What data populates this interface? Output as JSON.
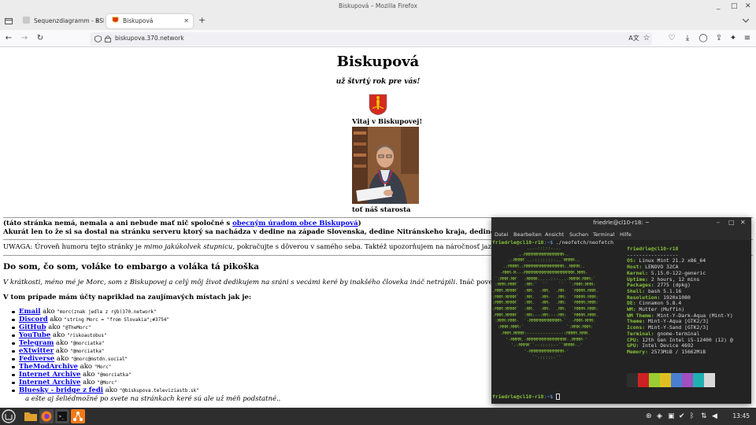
{
  "window": {
    "title": "Biskupová – Mozilla Firefox",
    "controls": [
      "_",
      "□",
      "✕"
    ]
  },
  "tabs": [
    {
      "label": "Sequenzdiagramm - BSIT1_I",
      "active": false
    },
    {
      "label": "Biskupová",
      "active": true
    }
  ],
  "new_tab_label": "+",
  "url": "biskupova.370.network",
  "page": {
    "title": "Biskupová",
    "subtitle": "už štvrtý rok pre vás!",
    "welcome": "Vitaj v Biskupovej!",
    "mayor_caption": "toť náš starosta",
    "disclaimer_pre": "(táto stránka nemá, nemala a ani nebude mať nič spoločné s ",
    "disclaimer_link": "obecným úradom obce Biskupová",
    "disclaimer_post": ")",
    "location": "Akurát len to že si sa dostal na stránku serveru ktorý sa nachádza v dedine na západe Slovenska, dedine Nitránskeho kraja, dedine v takej ri",
    "humor_pre": "UWAGA: Úroveň humoru tejto stránky je ",
    "humor_em": "mimo jakúkolvek stupnicu",
    "humor_post": ", pokračujte s dôverou v samého seba. Taktéž upozorňujem na náročnosť jazyka strán",
    "heading": "Do som, čo som, voláke to embargo a voláka tá pikoška",
    "intro_em": "V krátkosti, méno mé je Morc, som z Biskupovej a celý môj život dedikujem na sráni s vecámi keré by inakšého človeka ináč netrápili.",
    "intro_post": " Ináč povedané, rob",
    "places_heading": "V tom prípade mám účty napriklad na zaujímavých místach jak je:",
    "ako": "ako",
    "accounts": [
      {
        "service": "Email",
        "handle": "\"morc(znak jedla z rýb)370.network\""
      },
      {
        "service": "Discord",
        "handle": "\"string Morc = \"from Slovakia\";#3754\""
      },
      {
        "service": "GitHub",
        "handle": "\"@TheMorc\""
      },
      {
        "service": "YouTube",
        "handle": "\"riskoautobus\""
      },
      {
        "service": "Telegram",
        "handle": "\"@morciatka\""
      },
      {
        "service": "eXtwitter",
        "handle": "\"@morciatka\""
      },
      {
        "service": "Fediverse",
        "handle": "\"@morc@mstdn.social\""
      },
      {
        "service": "TheModArchive",
        "handle": "\"Morc\""
      },
      {
        "service": "Internet Archive",
        "handle": "\"@morciatka\""
      },
      {
        "service": "Internet Archive",
        "handle": "\"@Morc\""
      },
      {
        "service": "Bluesky - bridge z fedi",
        "handle": "\"@biskupova.televiziastb.sk\""
      }
    ],
    "closing": "a ešte aj šeliédmožné po svete na stránkach keré sú ale už méň podstatné.."
  },
  "terminal": {
    "title": "friedrle@cl10-r18: ~",
    "menu": [
      "Datei",
      "Bearbeiten",
      "Ansicht",
      "Suchen",
      "Terminal",
      "Hilfe"
    ],
    "prompt_user": "friedrle@cl10-r18",
    "prompt_path": ":~$",
    "command": " ./neofetch/neofetch",
    "header": "friedrle@cl10-r18",
    "separator": "-----------------",
    "info": [
      {
        "key": "OS",
        "value": "Linux Mint 21.2 x86_64"
      },
      {
        "key": "Host",
        "value": "LENOVO 32CA"
      },
      {
        "key": "Kernel",
        "value": "5.15.0-122-generic"
      },
      {
        "key": "Uptime",
        "value": "2 hours, 12 mins"
      },
      {
        "key": "Packages",
        "value": "2775 (dpkg)"
      },
      {
        "key": "Shell",
        "value": "bash 5.1.16"
      },
      {
        "key": "Resolution",
        "value": "1920x1080"
      },
      {
        "key": "DE",
        "value": "Cinnamon 5.8.4"
      },
      {
        "key": "WM",
        "value": "Mutter (Muffin)"
      },
      {
        "key": "WM Theme",
        "value": "Mint-Y-Dark-Aqua (Mint-Y)"
      },
      {
        "key": "Theme",
        "value": "Mint-Y-Aqua [GTK2/3]"
      },
      {
        "key": "Icons",
        "value": "Mint-Y-Sand [GTK2/3]"
      },
      {
        "key": "Terminal",
        "value": "gnome-terminal"
      },
      {
        "key": "CPU",
        "value": "12th Gen Intel i5-12400 (12) @"
      },
      {
        "key": "GPU",
        "value": "Intel Device 4692"
      },
      {
        "key": "Memory",
        "value": "2573MiB / 15662MiB"
      }
    ],
    "palette": [
      "#2e2e2e",
      "#cc2222",
      "#9acd32",
      "#e0c020",
      "#4a7fd0",
      "#a050c0",
      "#20b0b0",
      "#d8d8d8"
    ],
    "ascii": [
      "             ...-:::::-...",
      "          .-MMMMMMMMMMMMMMM-.",
      "      .-MMMM`..-:::::::-..`MMMM-.",
      "    .:MMMM.:MMMMMMMMMMMMMMM:.MMMM:.",
      "   -MMM-M---MMMMMMMMMMMMMMMMMMM.MMM-",
      " `:MMM:MM`  :MMMM:....::-...-MMMM:MMM:`",
      " :MMM:MMM`  :MM:`  ``    ``  `:MMM:MMM:",
      ".MMM.MMMM`  :MM.  -MM.  .MM-  `MMMM.MMM.",
      ":MMM:MMMM`  :MM.  -MM-  .MM:  `MMMM-MMM:",
      ":MMM:MMMM`  :MM.  -MM-  .MM:  `MMMM:MMM:",
      ":MMM:MMMM`  :MM.  -MM-  .MM:  `MMMM-MMM:",
      ".MMM.MMMM`  :MM:--:MM:--:MM:  `MMMM.MMM.",
      " :MMM:MMM-  `-MMMMMMMMMMMM-`  -MMM-MMM:",
      "  :MMM:MMM:`                `:MMM:MMM:",
      "   .MMM.MMMM:--------------:MMMM.MMM.",
      "     '-MMMM.-MMMMMMMMMMMMMMM-.MMMM-'",
      "       '.-MMMM``--:::::--``MMMM-.'",
      "            '-MMMMMMMMMMMMM-'",
      "               ``-:::::-``"
    ]
  },
  "taskbar": {
    "clock": "13:45"
  }
}
